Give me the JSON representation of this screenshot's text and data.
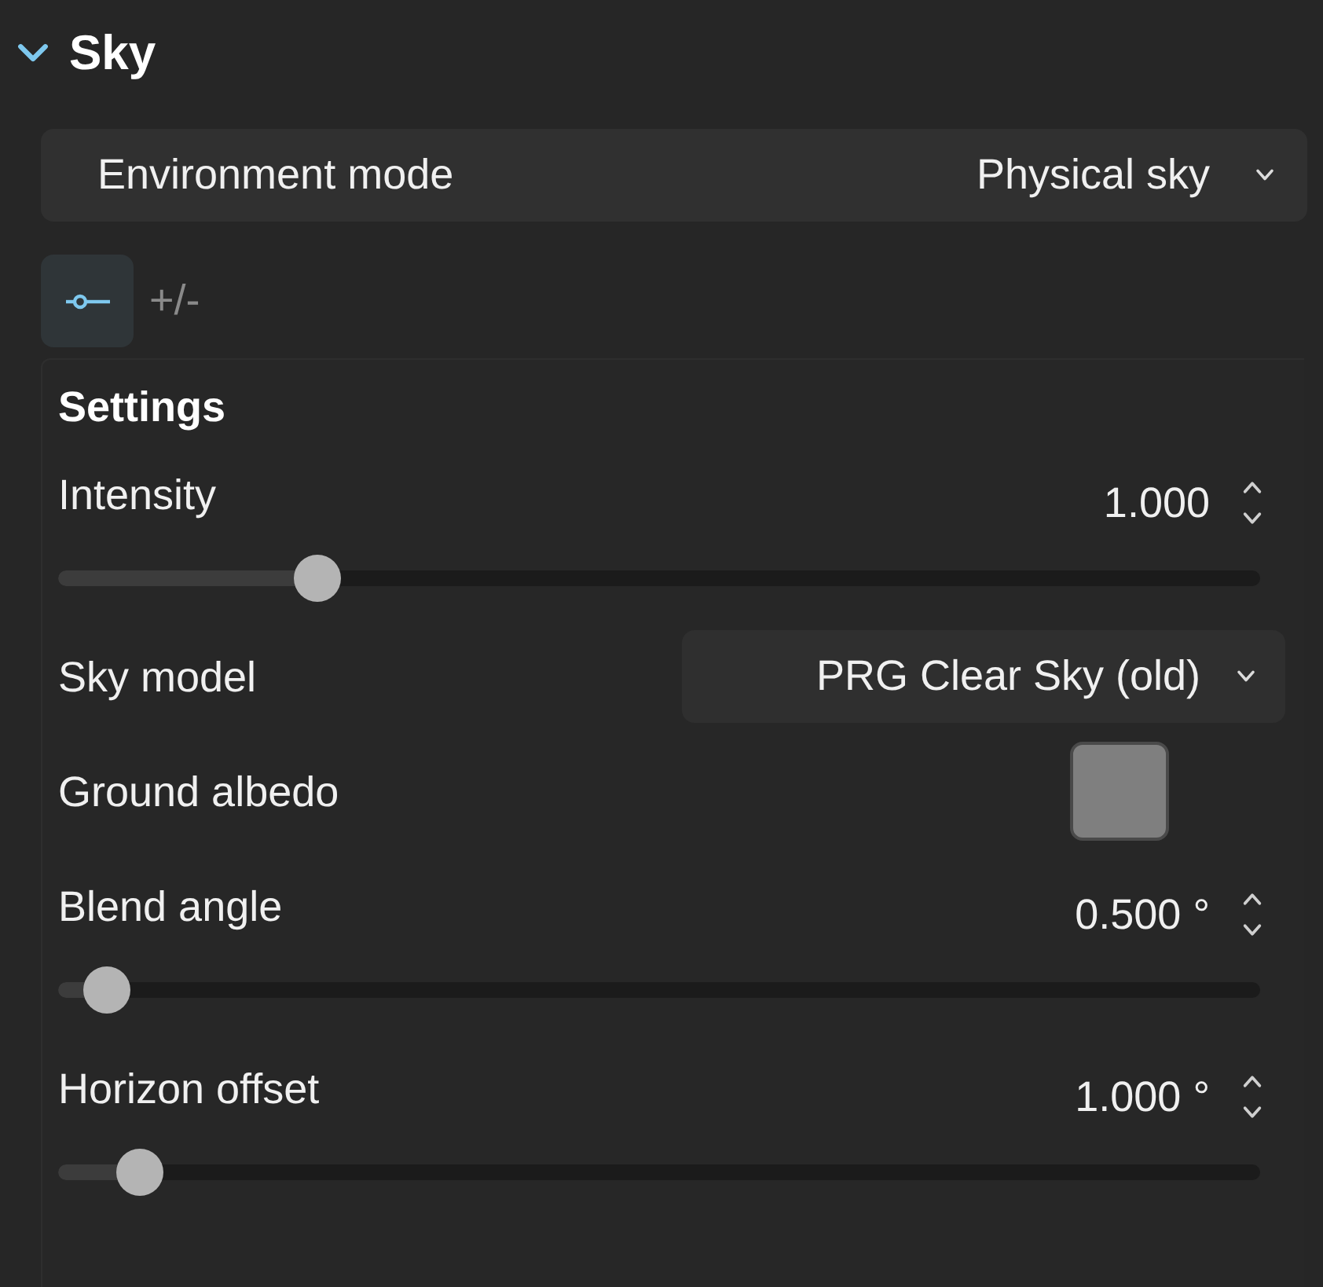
{
  "section": {
    "title": "Sky",
    "expanded": true
  },
  "environment_mode": {
    "label": "Environment mode",
    "value": "Physical sky"
  },
  "view_tabs": [
    {
      "kind": "icon",
      "selected": true
    },
    {
      "kind": "text",
      "label": "+/-",
      "selected": false
    }
  ],
  "settings": {
    "title": "Settings",
    "rows": [
      {
        "kind": "slider",
        "label": "Intensity",
        "value": "1.000",
        "level": 0.204
      },
      {
        "kind": "dropdown",
        "label": "Sky model",
        "value": "PRG Clear Sky (old)"
      },
      {
        "kind": "color",
        "label": "Ground albedo",
        "color": "#7f7f7f"
      },
      {
        "kind": "slider",
        "label": "Blend angle",
        "value": "0.500 °",
        "level": 0.022
      },
      {
        "kind": "slider",
        "label": "Horizon offset",
        "value": "1.000 °",
        "level": 0.05
      }
    ]
  }
}
